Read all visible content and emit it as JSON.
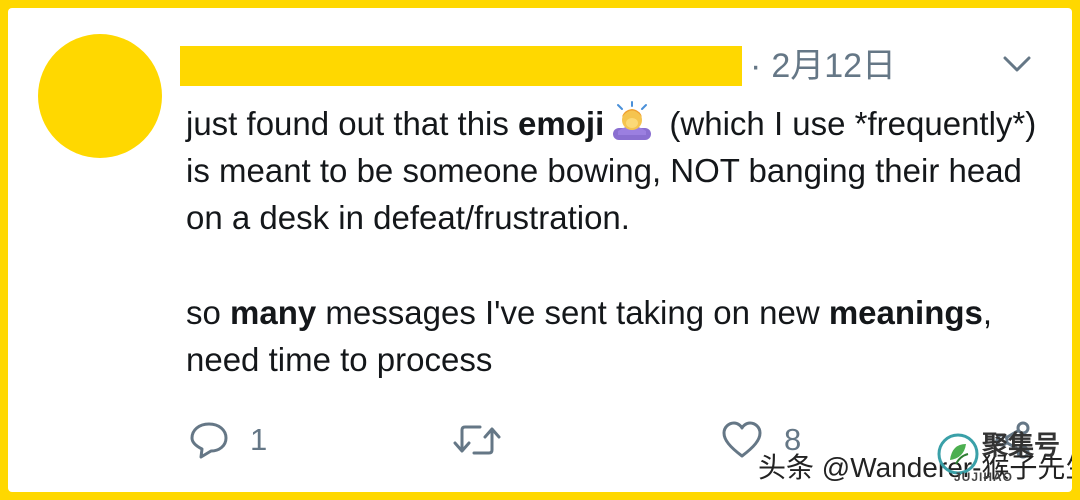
{
  "tweet": {
    "date": "2月12日",
    "separator": "·",
    "body": {
      "p1_a": "just found out that this ",
      "p1_b": "emoji",
      "p1_c": " (which I use *frequently*) is meant to be someone bowing, NOT banging their head on a desk in defeat/frustration.",
      "p2_a": "so ",
      "p2_b": "many",
      "p2_c": " messages I've sent taking on new ",
      "p2_d": "meanings",
      "p2_e": ", need time to process"
    },
    "emoji_name": "person-bowing-emoji",
    "actions": {
      "reply_count": "1",
      "retweet_count": "",
      "like_count": "8"
    }
  },
  "icons": [
    "avatar",
    "chevron-down-icon",
    "reply-icon",
    "retweet-icon",
    "heart-icon",
    "share-icon"
  ],
  "colors": {
    "frame": "#ffd800",
    "card": "#ffffff",
    "text": "#14171a",
    "muted": "#657786"
  },
  "watermark": {
    "text": "头条 @Wanderer-猴子先生",
    "brand": "聚集号",
    "brand_en": "JUJIHAO"
  }
}
